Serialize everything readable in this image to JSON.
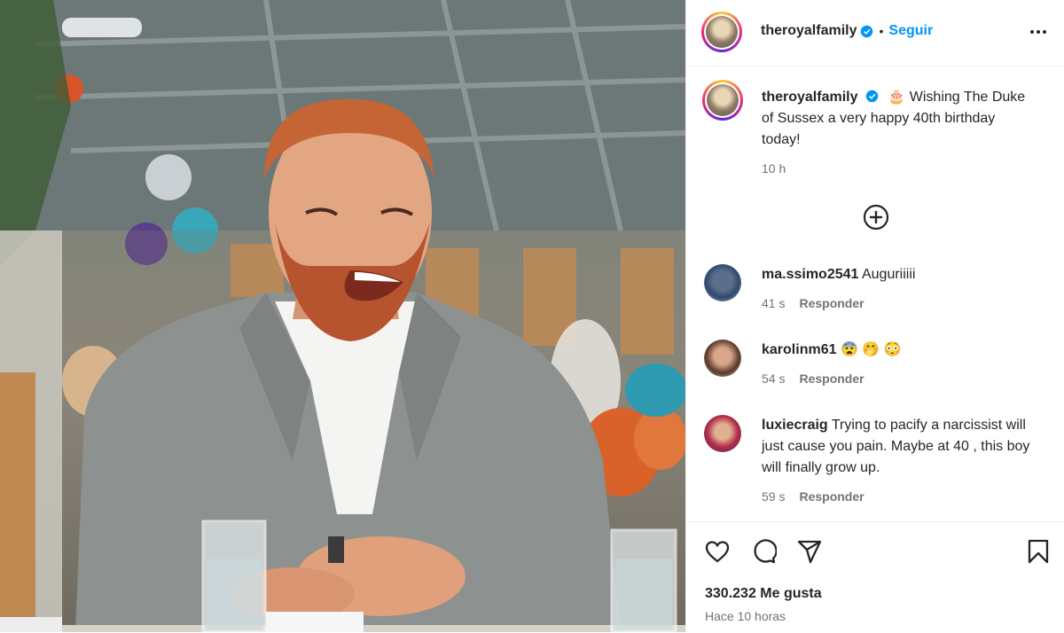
{
  "post": {
    "photo_alt": "Prince Harry laughing at a table",
    "header": {
      "username": "theroyalfamily",
      "follow_label": "Seguir",
      "separator": "•"
    },
    "caption": {
      "username": "theroyalfamily",
      "emoji": "🎂",
      "text": "Wishing The Duke of Sussex a very happy 40th birthday today!",
      "time": "10 h"
    },
    "comments": [
      {
        "username": "ma.ssimo2541",
        "text": "Auguriiiii",
        "time": "41 s",
        "reply": "Responder"
      },
      {
        "username": "karolinm61",
        "text": "😨 🤭 😳",
        "time": "54 s",
        "reply": "Responder"
      },
      {
        "username": "luxiecraig",
        "text": "Trying to pacify a narcissist will just cause you pain. Maybe at 40 , this boy will finally grow up.",
        "time": "59 s",
        "reply": "Responder"
      }
    ],
    "likes": "330.232 Me gusta",
    "posted_ago": "Hace 10 horas"
  },
  "colors": {
    "accent": "#0095f6",
    "verified": "#0095f6",
    "muted": "#737373",
    "text": "#262626"
  },
  "icons": [
    "verified-badge-icon",
    "more-options-icon",
    "plus-circle-icon",
    "heart-icon",
    "comment-icon",
    "share-icon",
    "bookmark-icon"
  ]
}
